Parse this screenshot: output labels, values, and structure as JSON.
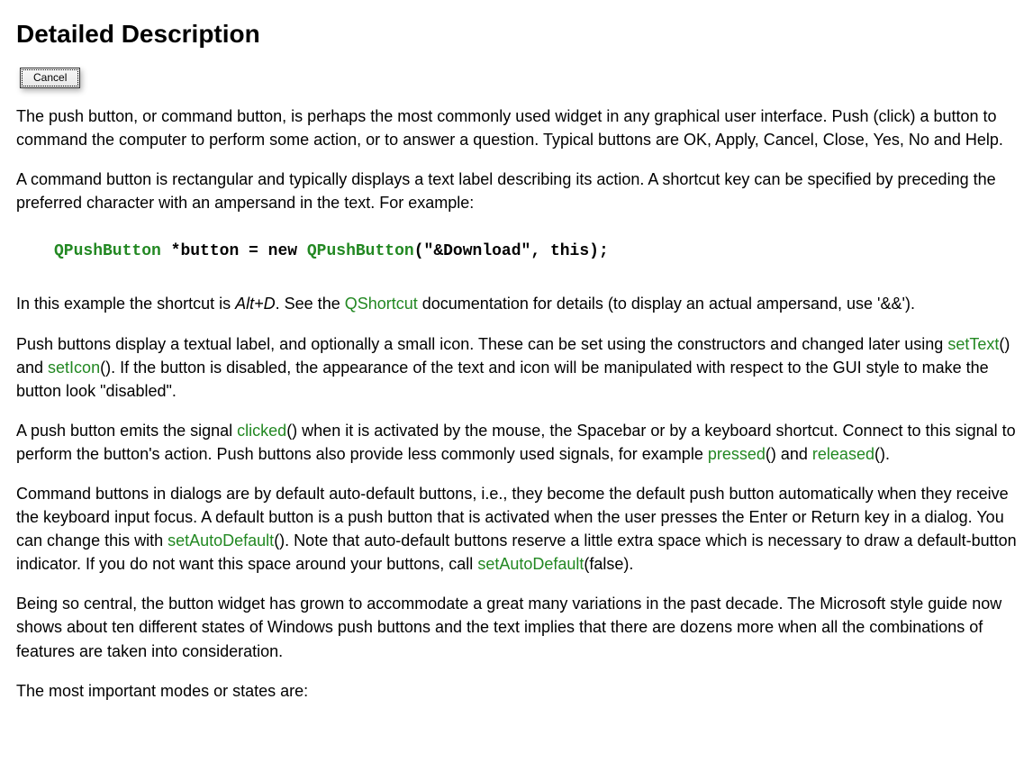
{
  "heading": "Detailed Description",
  "demo_button_label": "Cancel",
  "p1": "The push button, or command button, is perhaps the most commonly used widget in any graphical user interface. Push (click) a button to command the computer to perform some action, or to answer a question. Typical buttons are OK, Apply, Cancel, Close, Yes, No and Help.",
  "p2": "A command button is rectangular and typically displays a text label describing its action. A shortcut key can be specified by preceding the preferred character with an ampersand in the text. For example:",
  "code": {
    "type1": "QPushButton",
    "op1": " *",
    "id1": "button",
    "op2": " = ",
    "kw1": "new",
    "sp1": " ",
    "type2": "QPushButton",
    "paren_open": "(",
    "str1": "\"&Download\"",
    "comma": ", ",
    "kw2": "this",
    "paren_close": ");"
  },
  "p3_a": "In this example the shortcut is ",
  "p3_kbd": "Alt+D",
  "p3_b": ". See the ",
  "p3_link1": "QShortcut",
  "p3_c": " documentation for details (to display an actual ampersand, use '&&').",
  "p4_a": "Push buttons display a textual label, and optionally a small icon. These can be set using the constructors and changed later using ",
  "p4_link1": "setText",
  "p4_b": "() and ",
  "p4_link2": "setIcon",
  "p4_c": "(). If the button is disabled, the appearance of the text and icon will be manipulated with respect to the GUI style to make the button look \"disabled\".",
  "p5_a": "A push button emits the signal ",
  "p5_link1": "clicked",
  "p5_b": "() when it is activated by the mouse, the Spacebar or by a keyboard shortcut. Connect to this signal to perform the button's action. Push buttons also provide less commonly used signals, for example ",
  "p5_link2": "pressed",
  "p5_c": "() and ",
  "p5_link3": "released",
  "p5_d": "().",
  "p6_a": "Command buttons in dialogs are by default auto-default buttons, i.e., they become the default push button automatically when they receive the keyboard input focus. A default button is a push button that is activated when the user presses the Enter or Return key in a dialog. You can change this with ",
  "p6_link1": "setAutoDefault",
  "p6_b": "(). Note that auto-default buttons reserve a little extra space which is necessary to draw a default-button indicator. If you do not want this space around your buttons, call ",
  "p6_link2": "setAutoDefault",
  "p6_c": "(false).",
  "p7": "Being so central, the button widget has grown to accommodate a great many variations in the past decade. The Microsoft style guide now shows about ten different states of Windows push buttons and the text implies that there are dozens more when all the combinations of features are taken into consideration.",
  "p8": "The most important modes or states are:"
}
